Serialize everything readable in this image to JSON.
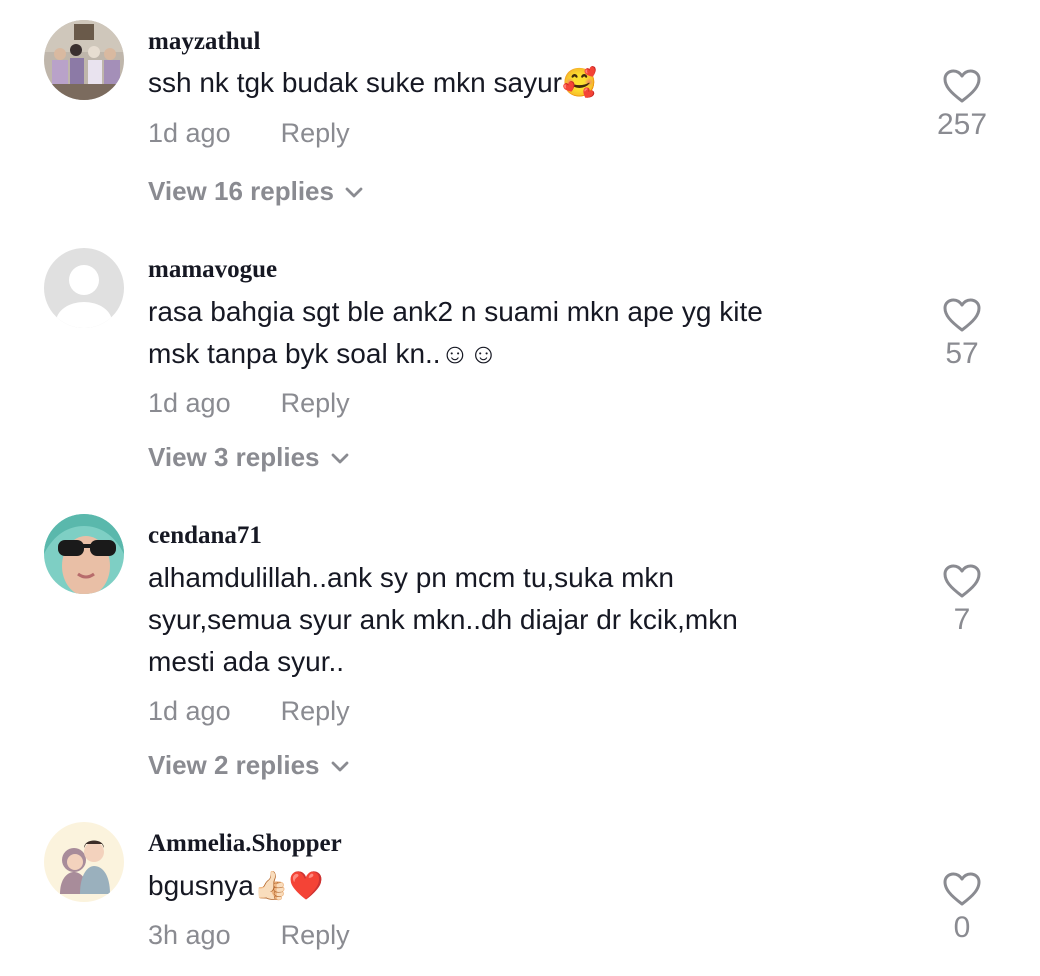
{
  "comments": [
    {
      "username": "mayzathul",
      "text": "ssh nk tgk budak suke mkn sayur🥰",
      "time": "1d ago",
      "reply_label": "Reply",
      "likes": "257",
      "view_replies": "View 16 replies"
    },
    {
      "username": "mamavogue",
      "text": "rasa bahgia sgt ble ank2 n suami mkn ape yg kite\nmsk tanpa byk soal kn..☺︎☺︎",
      "time": "1d ago",
      "reply_label": "Reply",
      "likes": "57",
      "view_replies": "View 3 replies"
    },
    {
      "username": "cendana71",
      "text": "alhamdulillah..ank sy pn mcm tu,suka mkn\nsyur,semua syur ank mkn..dh diajar dr kcik,mkn\nmesti ada syur..",
      "time": "1d ago",
      "reply_label": "Reply",
      "likes": "7",
      "view_replies": "View 2 replies"
    },
    {
      "username": "Ammelia.Shopper",
      "text": "bgusnya👍🏻❤️",
      "time": "3h ago",
      "reply_label": "Reply",
      "likes": "0"
    }
  ],
  "icons": {
    "like": "heart-outline-icon",
    "expand": "chevron-down-icon"
  },
  "colors": {
    "primary_text": "#161823",
    "secondary_text": "#8a8b91"
  }
}
